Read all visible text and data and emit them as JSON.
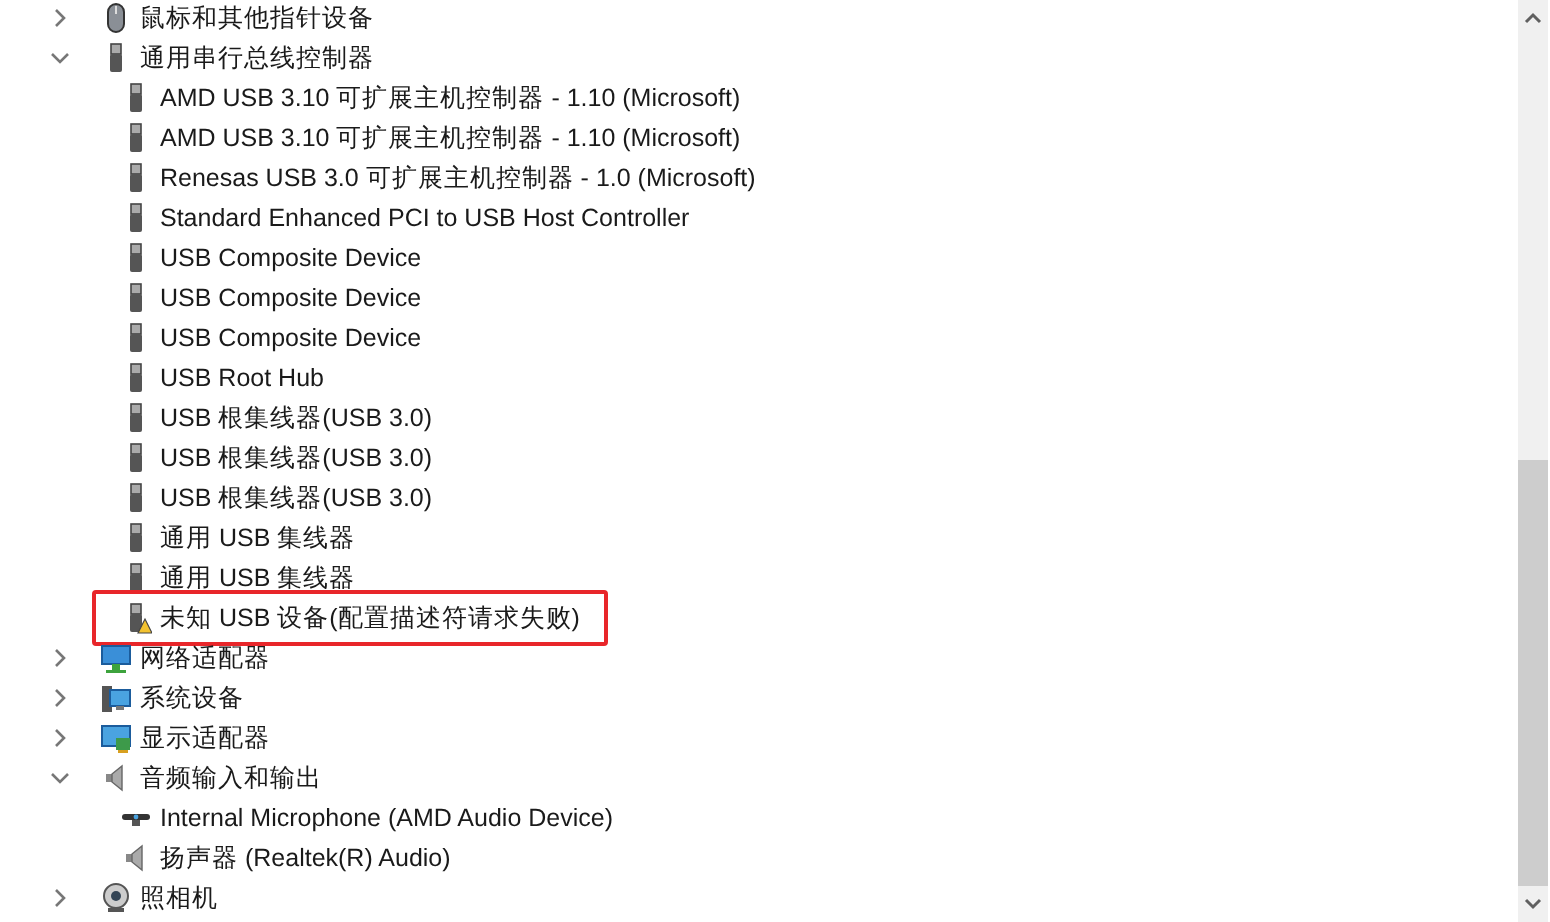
{
  "tree": [
    {
      "label": "鼠标和其他指针设备",
      "kind": "mouse",
      "expanded": false
    },
    {
      "label": "通用串行总线控制器",
      "kind": "usb",
      "expanded": true,
      "children": [
        {
          "label": "AMD USB 3.10 可扩展主机控制器 - 1.10 (Microsoft)",
          "kind": "usb",
          "problem": false,
          "highlighted": false
        },
        {
          "label": "AMD USB 3.10 可扩展主机控制器 - 1.10 (Microsoft)",
          "kind": "usb",
          "problem": false,
          "highlighted": false
        },
        {
          "label": "Renesas USB 3.0 可扩展主机控制器 - 1.0 (Microsoft)",
          "kind": "usb",
          "problem": false,
          "highlighted": false
        },
        {
          "label": "Standard Enhanced PCI to USB Host Controller",
          "kind": "usb",
          "problem": false,
          "highlighted": false
        },
        {
          "label": "USB Composite Device",
          "kind": "usb",
          "problem": false,
          "highlighted": false
        },
        {
          "label": "USB Composite Device",
          "kind": "usb",
          "problem": false,
          "highlighted": false
        },
        {
          "label": "USB Composite Device",
          "kind": "usb",
          "problem": false,
          "highlighted": false
        },
        {
          "label": "USB Root Hub",
          "kind": "usb",
          "problem": false,
          "highlighted": false
        },
        {
          "label": "USB 根集线器(USB 3.0)",
          "kind": "usb",
          "problem": false,
          "highlighted": false
        },
        {
          "label": "USB 根集线器(USB 3.0)",
          "kind": "usb",
          "problem": false,
          "highlighted": false
        },
        {
          "label": "USB 根集线器(USB 3.0)",
          "kind": "usb",
          "problem": false,
          "highlighted": false
        },
        {
          "label": "通用 USB 集线器",
          "kind": "usb",
          "problem": false,
          "highlighted": false
        },
        {
          "label": "通用 USB 集线器",
          "kind": "usb",
          "problem": false,
          "highlighted": false
        },
        {
          "label": "未知 USB 设备(配置描述符请求失败)",
          "kind": "usb",
          "problem": true,
          "highlighted": true
        }
      ]
    },
    {
      "label": "网络适配器",
      "kind": "network",
      "expanded": false
    },
    {
      "label": "系统设备",
      "kind": "system",
      "expanded": false
    },
    {
      "label": "显示适配器",
      "kind": "display",
      "expanded": false
    },
    {
      "label": "音频输入和输出",
      "kind": "speaker",
      "expanded": true,
      "children": [
        {
          "label": "Internal Microphone (AMD Audio Device)",
          "kind": "microphone",
          "problem": false,
          "highlighted": false
        },
        {
          "label": "扬声器 (Realtek(R) Audio)",
          "kind": "speaker",
          "problem": false,
          "highlighted": false
        }
      ]
    },
    {
      "label": "照相机",
      "kind": "camera",
      "expanded": false
    }
  ]
}
